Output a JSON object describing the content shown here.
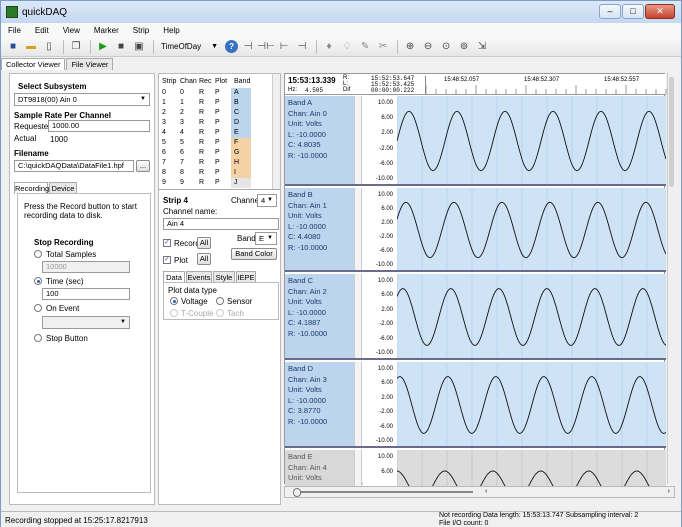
{
  "window": {
    "title": "quickDAQ"
  },
  "menu": [
    "File",
    "Edit",
    "View",
    "Marker",
    "Strip",
    "Help"
  ],
  "toolbar": {
    "time_mode": "TimeOfDay"
  },
  "tabs": [
    {
      "label": "Collector Viewer",
      "active": true
    },
    {
      "label": "File Viewer",
      "active": false
    }
  ],
  "left": {
    "select_subsystem_label": "Select Subsystem",
    "subsystem_value": "DT9818(00) Ain 0",
    "sample_rate_label": "Sample Rate Per Channel",
    "requested_label": "Requested",
    "requested_value": "1000.00",
    "actual_label": "Actual",
    "actual_value": "1000",
    "filename_label": "Filename",
    "filename_value": "C:\\quickDAQData\\DataFile1.hpf",
    "browse_label": "...",
    "subtabs": [
      {
        "label": "Recording"
      },
      {
        "label": "Device"
      }
    ],
    "record_hint": "Press the Record button to start recording data to disk.",
    "stop_recording_label": "Stop Recording",
    "total_samples_label": "Total Samples",
    "total_samples_value": "10000",
    "time_label": "Time (sec)",
    "time_value": "100",
    "on_event_label": "On Event",
    "stop_button_label": "Stop Button"
  },
  "strip_table": {
    "headers": [
      "Strip",
      "Chan",
      "Rec",
      "Plot",
      "Band"
    ],
    "rows": [
      [
        "0",
        "0",
        "R",
        "P",
        "A"
      ],
      [
        "1",
        "1",
        "R",
        "P",
        "B"
      ],
      [
        "2",
        "2",
        "R",
        "P",
        "C"
      ],
      [
        "3",
        "3",
        "R",
        "P",
        "D"
      ],
      [
        "4",
        "4",
        "R",
        "P",
        "E"
      ],
      [
        "5",
        "5",
        "R",
        "P",
        "F"
      ],
      [
        "6",
        "6",
        "R",
        "P",
        "G"
      ],
      [
        "7",
        "7",
        "R",
        "P",
        "H"
      ],
      [
        "8",
        "8",
        "R",
        "P",
        "I"
      ],
      [
        "9",
        "9",
        "R",
        "P",
        "J"
      ]
    ]
  },
  "strip_detail": {
    "title": "Strip 4",
    "channel_label": "Channel",
    "channel_value": "4",
    "channel_name_label": "Channel name:",
    "channel_name_value": "Ain 4",
    "record_label": "Record",
    "all_label": "All",
    "band_label": "Band",
    "band_value": "E",
    "plot_label": "Plot",
    "band_color_label": "Band Color",
    "tabs": [
      "Data",
      "Events",
      "Style",
      "IEPE"
    ],
    "plot_data_type_label": "Plot data type",
    "voltage_label": "Voltage",
    "sensor_label": "Sensor",
    "tcouple_label": "T-Couple",
    "tach_label": "Tach"
  },
  "timeaxis": {
    "current_time": "15:53:13.339",
    "r_label": "R:",
    "r_value": "15:52:53.647",
    "l_label": "L:",
    "l_value": "15:52:53.425",
    "dif_label": "Dif",
    "dif_value": "00:00:00.222",
    "hz_label": "Hz:",
    "hz_value": "4.505",
    "ticks": [
      "15:48:52.057",
      "15:48:52.307",
      "15:48:52.557"
    ]
  },
  "bands": [
    {
      "band": "Band A",
      "chan": "Chan: Ain 0",
      "unit": "Unit: Volts",
      "l": "L: -10.0000",
      "c": "C: 4.8035",
      "r": "R: -10.0000",
      "scale": [
        "10.00",
        "6.00",
        "2.00",
        "-2.00",
        "-6.00",
        "-10.00"
      ]
    },
    {
      "band": "Band B",
      "chan": "Chan: Ain 1",
      "unit": "Unit: Volts",
      "l": "L: -10.0000",
      "c": "C: 4.4080",
      "r": "R: -10.0000",
      "scale": [
        "10.00",
        "6.00",
        "2.00",
        "-2.00",
        "-6.00",
        "-10.00"
      ]
    },
    {
      "band": "Band C",
      "chan": "Chan: Ain 2",
      "unit": "Unit: Volts",
      "l": "L: -10.0000",
      "c": "C: 4.1887",
      "r": "R: -10.0000",
      "scale": [
        "10.00",
        "6.00",
        "2.00",
        "-2.00",
        "-6.00",
        "-10.00"
      ]
    },
    {
      "band": "Band D",
      "chan": "Chan: Ain 3",
      "unit": "Unit: Volts",
      "l": "L: -10.0000",
      "c": "C: 3.8770",
      "r": "R: -10.0000",
      "scale": [
        "10.00",
        "6.00",
        "2.00",
        "-2.00",
        "-6.00",
        "-10.00"
      ]
    },
    {
      "band": "Band E",
      "chan": "Chan: Ain 4",
      "unit": "Unit: Volts",
      "l": "",
      "c": "",
      "r": "",
      "scale": [
        "10.00",
        "6.00"
      ]
    }
  ],
  "status": {
    "left": "Recording stopped at 15:25:17.8217913",
    "right_line1": "Not recording   Data length: 15:53:13.747   Subsampling interval: 2",
    "right_line2": "File I/O count: 0"
  }
}
